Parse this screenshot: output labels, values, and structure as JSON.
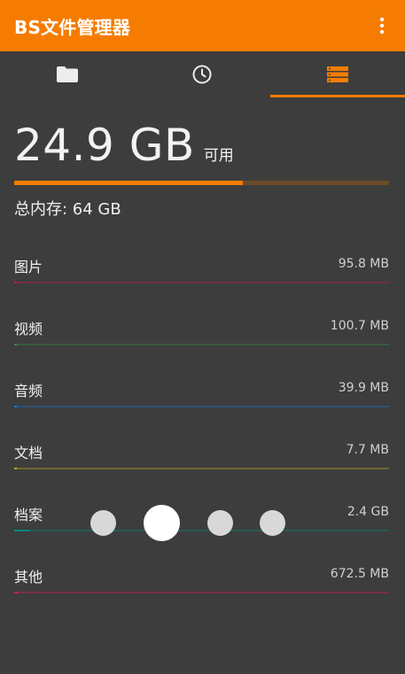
{
  "app": {
    "title": "BS文件管理器"
  },
  "tabs": [
    {
      "icon": "folder-icon"
    },
    {
      "icon": "clock-icon"
    },
    {
      "icon": "storage-icon",
      "active": true
    }
  ],
  "storage": {
    "free_value": "24.9 GB",
    "free_label": "可用",
    "total_label": "总内存: 64 GB",
    "used_fraction": 0.61
  },
  "categories": [
    {
      "name": "图片",
      "size": "95.8 MB",
      "color": "#c2185b",
      "fraction": 0.002
    },
    {
      "name": "视频",
      "size": "100.7 MB",
      "color": "#388e3c",
      "fraction": 0.002
    },
    {
      "name": "音频",
      "size": "39.9 MB",
      "color": "#1976d2",
      "fraction": 0.001
    },
    {
      "name": "文档",
      "size": "7.7 MB",
      "color": "#c9a227",
      "fraction": 0.0005
    },
    {
      "name": "档案",
      "size": "2.4 GB",
      "color": "#00897b",
      "fraction": 0.04
    },
    {
      "name": "其他",
      "size": "672.5 MB",
      "color": "#d81b60",
      "fraction": 0.01
    }
  ],
  "colors": {
    "accent": "#f57c00",
    "background": "#3d3d3d"
  }
}
